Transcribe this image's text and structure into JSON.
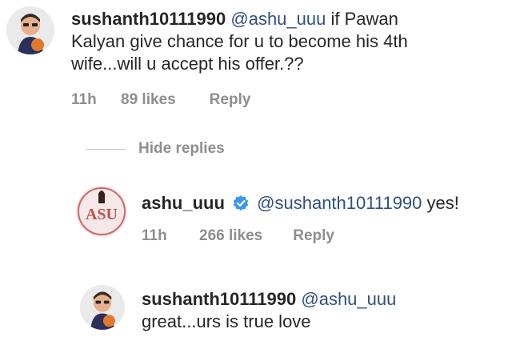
{
  "comments": [
    {
      "username": "sushanth10111990",
      "mention": "@ashu_uuu",
      "text_line1": " if Pawan",
      "text_line2": "Kalyan give chance for u to become his 4th",
      "text_line3": "wife...will u accept his offer.??",
      "time": "11h",
      "likes": "89 likes",
      "reply": "Reply"
    },
    {
      "username": "ashu_uuu",
      "mention": "@sushanth10111990",
      "text": " yes!",
      "time": "11h",
      "likes": "266 likes",
      "reply": "Reply",
      "avatar_text": "ASU"
    },
    {
      "username": "sushanth10111990",
      "mention": "@ashu_uuu",
      "text": "great...urs is true love"
    }
  ],
  "hide_replies": "Hide replies",
  "colors": {
    "mention": "#2f4f7f",
    "meta": "#8e8e8e",
    "verified": "#3897f0"
  }
}
